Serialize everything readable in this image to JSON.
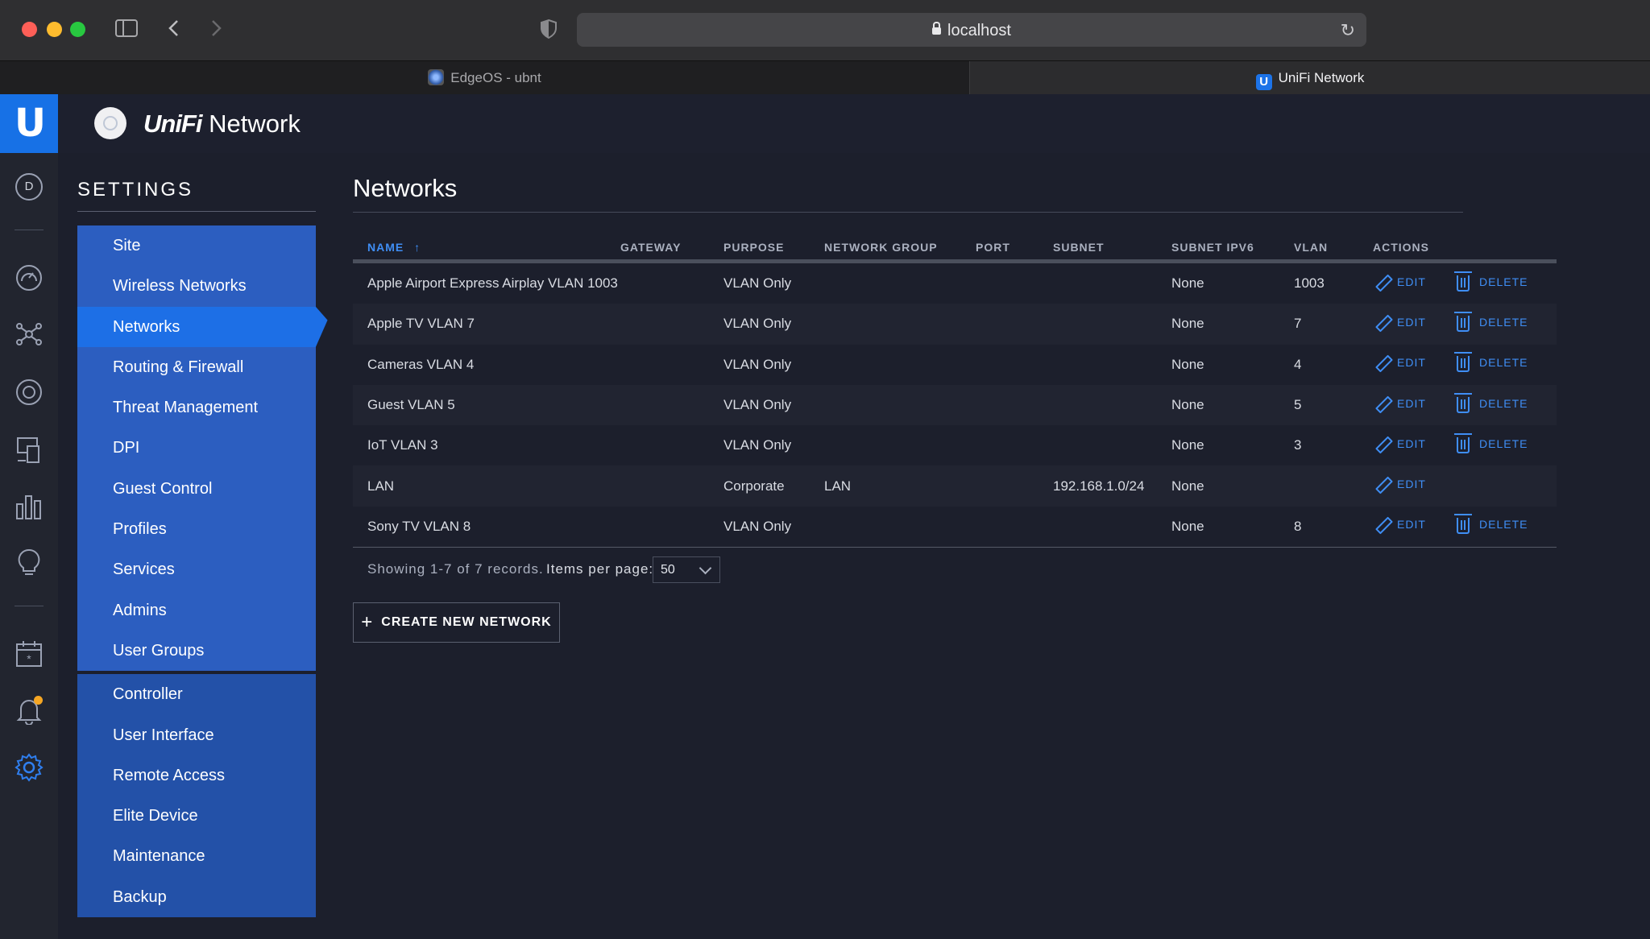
{
  "browser": {
    "url": "localhost",
    "tabs": [
      {
        "label": "EdgeOS - ubnt"
      },
      {
        "label": "UniFi Network"
      }
    ]
  },
  "app": {
    "brand_bold": "UniFi",
    "brand_rest": "Network",
    "rail_avatar": "D"
  },
  "settings": {
    "title": "SETTINGS",
    "items": [
      {
        "label": "Site"
      },
      {
        "label": "Wireless Networks"
      },
      {
        "label": "Networks"
      },
      {
        "label": "Routing & Firewall"
      },
      {
        "label": "Threat Management"
      },
      {
        "label": "DPI"
      },
      {
        "label": "Guest Control"
      },
      {
        "label": "Profiles"
      },
      {
        "label": "Services"
      },
      {
        "label": "Admins"
      },
      {
        "label": "User Groups"
      },
      {
        "label": "Controller"
      },
      {
        "label": "User Interface"
      },
      {
        "label": "Remote Access"
      },
      {
        "label": "Elite Device"
      },
      {
        "label": "Maintenance"
      },
      {
        "label": "Backup"
      }
    ],
    "active": "Networks"
  },
  "main": {
    "title": "Networks",
    "columns": {
      "name": "NAME",
      "gateway": "GATEWAY",
      "purpose": "PURPOSE",
      "network_group": "NETWORK GROUP",
      "port": "PORT",
      "subnet": "SUBNET",
      "subnet_ipv6": "SUBNET IPV6",
      "vlan": "VLAN",
      "actions": "ACTIONS"
    },
    "sort_indicator": "↑",
    "rows": [
      {
        "name": "Apple Airport Express Airplay VLAN 1003",
        "gateway": "",
        "purpose": "VLAN Only",
        "network_group": "",
        "port": "",
        "subnet": "",
        "subnet_ipv6": "None",
        "vlan": "1003",
        "edit": "EDIT",
        "delete": "DELETE"
      },
      {
        "name": "Apple TV VLAN 7",
        "gateway": "",
        "purpose": "VLAN Only",
        "network_group": "",
        "port": "",
        "subnet": "",
        "subnet_ipv6": "None",
        "vlan": "7",
        "edit": "EDIT",
        "delete": "DELETE"
      },
      {
        "name": "Cameras VLAN 4",
        "gateway": "",
        "purpose": "VLAN Only",
        "network_group": "",
        "port": "",
        "subnet": "",
        "subnet_ipv6": "None",
        "vlan": "4",
        "edit": "EDIT",
        "delete": "DELETE"
      },
      {
        "name": "Guest VLAN 5",
        "gateway": "",
        "purpose": "VLAN Only",
        "network_group": "",
        "port": "",
        "subnet": "",
        "subnet_ipv6": "None",
        "vlan": "5",
        "edit": "EDIT",
        "delete": "DELETE"
      },
      {
        "name": "IoT VLAN 3",
        "gateway": "",
        "purpose": "VLAN Only",
        "network_group": "",
        "port": "",
        "subnet": "",
        "subnet_ipv6": "None",
        "vlan": "3",
        "edit": "EDIT",
        "delete": "DELETE"
      },
      {
        "name": "LAN",
        "gateway": "",
        "purpose": "Corporate",
        "network_group": "LAN",
        "port": "",
        "subnet": "192.168.1.0/24",
        "subnet_ipv6": "None",
        "vlan": "",
        "edit": "EDIT",
        "delete": ""
      },
      {
        "name": "Sony TV VLAN 8",
        "gateway": "",
        "purpose": "VLAN Only",
        "network_group": "",
        "port": "",
        "subnet": "",
        "subnet_ipv6": "None",
        "vlan": "8",
        "edit": "EDIT",
        "delete": "DELETE"
      }
    ],
    "showing": "Showing 1-7 of 7 records.",
    "items_per_page_label": "Items per page:",
    "items_per_page_value": "50",
    "create_button": "CREATE NEW NETWORK"
  },
  "colors": {
    "accent": "#1d6fe6",
    "link": "#3f8ef5",
    "background": "#1c1f2c"
  }
}
